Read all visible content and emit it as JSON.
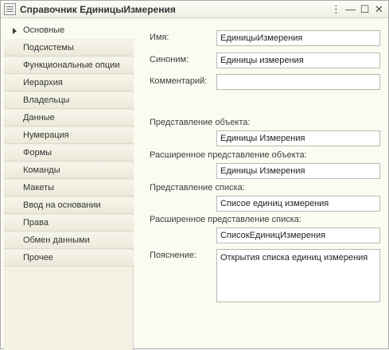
{
  "window": {
    "title": "Справочник ЕдиницыИзмерения",
    "icon": "form-icon",
    "controls": {
      "menu": "⋮",
      "minimize": "—",
      "maximize": "☐",
      "close": "✕"
    }
  },
  "sidebar": {
    "items": [
      {
        "label": "Основные",
        "active": true
      },
      {
        "label": "Подсистемы"
      },
      {
        "label": "Функциональные опции"
      },
      {
        "label": "Иерархия"
      },
      {
        "label": "Владельцы"
      },
      {
        "label": "Данные"
      },
      {
        "label": "Нумерация"
      },
      {
        "label": "Формы"
      },
      {
        "label": "Команды"
      },
      {
        "label": "Макеты"
      },
      {
        "label": "Ввод на основании"
      },
      {
        "label": "Права"
      },
      {
        "label": "Обмен данными"
      },
      {
        "label": "Прочее"
      }
    ]
  },
  "form": {
    "name_label": "Имя:",
    "name_value": "ЕдиницыИзмерения",
    "synonym_label": "Синоним:",
    "synonym_value": "Единицы измерения",
    "comment_label": "Комментарий:",
    "comment_value": "",
    "object_presentation_label": "Представление объекта:",
    "object_presentation_value": "Единицы Измерения",
    "ext_object_presentation_label": "Расширенное представление объекта:",
    "ext_object_presentation_value": "Единицы Измерения",
    "list_presentation_label": "Представление списка:",
    "list_presentation_value": "Списое единиц измерения",
    "ext_list_presentation_label": "Расширенное представление списка:",
    "ext_list_presentation_value": "СписокЕдиницИзмерения",
    "explanation_label": "Пояснение:",
    "explanation_value": "Открытия списка единиц измерения"
  }
}
